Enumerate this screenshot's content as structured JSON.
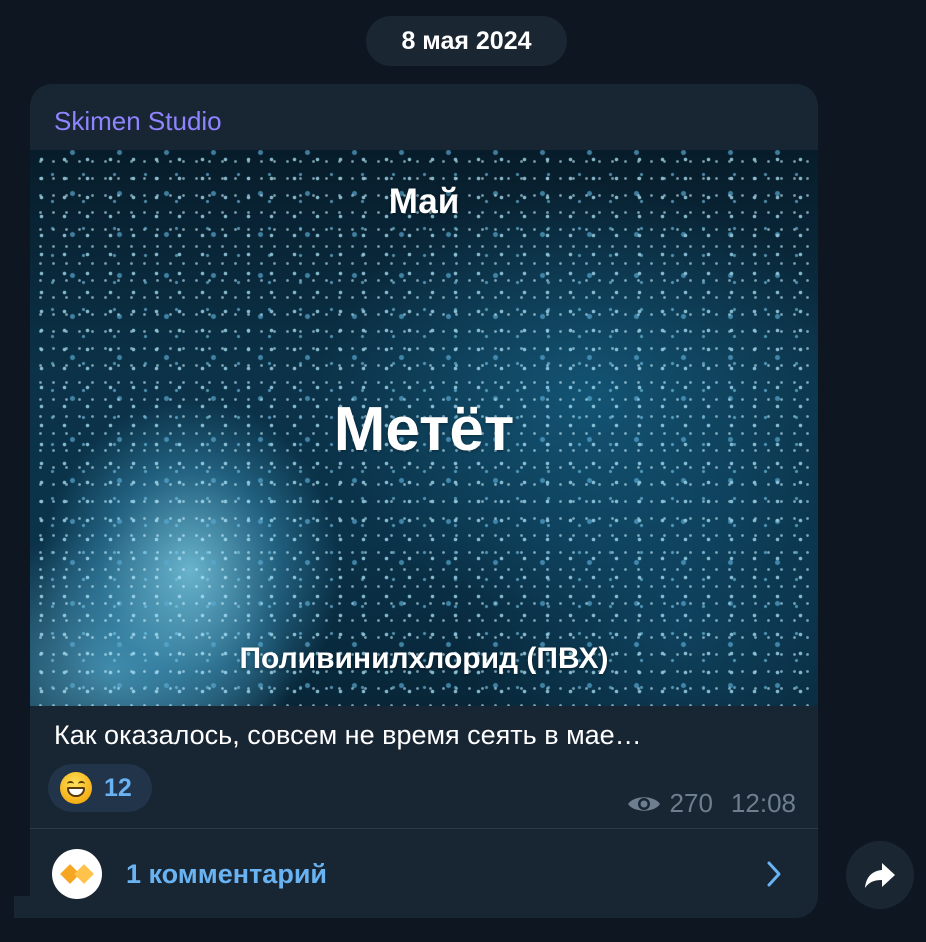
{
  "date_separator": "8 мая 2024",
  "post": {
    "channel_name": "Skimen Studio",
    "media": {
      "overlay_top": "Май",
      "overlay_title": "Метёт",
      "overlay_bottom": "Поливинилхлорид (ПВХ)"
    },
    "caption": "Как оказалось, совсем не время сеять в мае…",
    "reaction": {
      "emoji_icon": "grinning-face-icon",
      "count": "12"
    },
    "views": "270",
    "time": "12:08",
    "comments": {
      "label": "1 комментарий",
      "avatar_icon": "diamond-logo-icon",
      "chevron_icon": "chevron-right-icon"
    }
  },
  "share_icon": "share-arrow-icon",
  "colors": {
    "background": "#0e1621",
    "bubble": "#182533",
    "channel_name": "#8f84ff",
    "link": "#6ab3f3",
    "meta": "#6d7f8f"
  }
}
